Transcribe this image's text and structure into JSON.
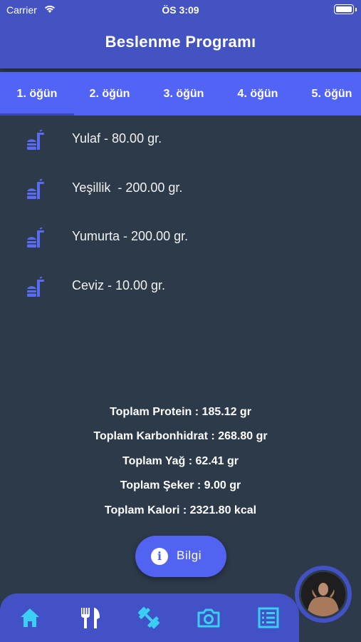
{
  "status_bar": {
    "carrier": "Carrier",
    "time": "ÖS 3:09"
  },
  "header": {
    "title": "Beslenme Programı"
  },
  "tabs": [
    {
      "label": "1. öğün",
      "active": true
    },
    {
      "label": "2. öğün"
    },
    {
      "label": "3. öğün"
    },
    {
      "label": "4. öğün"
    },
    {
      "label": "5. öğün"
    }
  ],
  "meal_items": [
    {
      "label": "Yulaf - 80.00 gr.",
      "icon": "burger-drink-icon"
    },
    {
      "label": "Yeşillik  - 200.00 gr.",
      "icon": "burger-drink-icon"
    },
    {
      "label": "Yumurta - 200.00 gr.",
      "icon": "burger-drink-icon"
    },
    {
      "label": "Ceviz - 10.00 gr.",
      "icon": "burger-drink-icon"
    }
  ],
  "totals": {
    "protein": "Toplam Protein : 185.12 gr",
    "carbs": "Toplam Karbonhidrat : 268.80 gr",
    "fat": "Toplam Yağ : 62.41 gr",
    "sugar": "Toplam Şeker : 9.00 gr",
    "calories": "Toplam Kalori : 2321.80 kcal"
  },
  "info_button": {
    "label": "Bilgi",
    "icon": "info-icon"
  },
  "bottom_nav": [
    {
      "name": "home",
      "icon": "home-icon"
    },
    {
      "name": "meal",
      "icon": "fork-knife-icon"
    },
    {
      "name": "workout",
      "icon": "dumbbell-icon"
    },
    {
      "name": "camera",
      "icon": "camera-icon"
    },
    {
      "name": "list",
      "icon": "list-icon"
    }
  ],
  "colors": {
    "header_bg": "#4453c2",
    "tab_bg": "#5264f5",
    "body_bg": "#2d3a4a",
    "accent": "#5263f2",
    "nav_icon_active": "#3ad0f5",
    "nav_icon": "#ffffff"
  }
}
